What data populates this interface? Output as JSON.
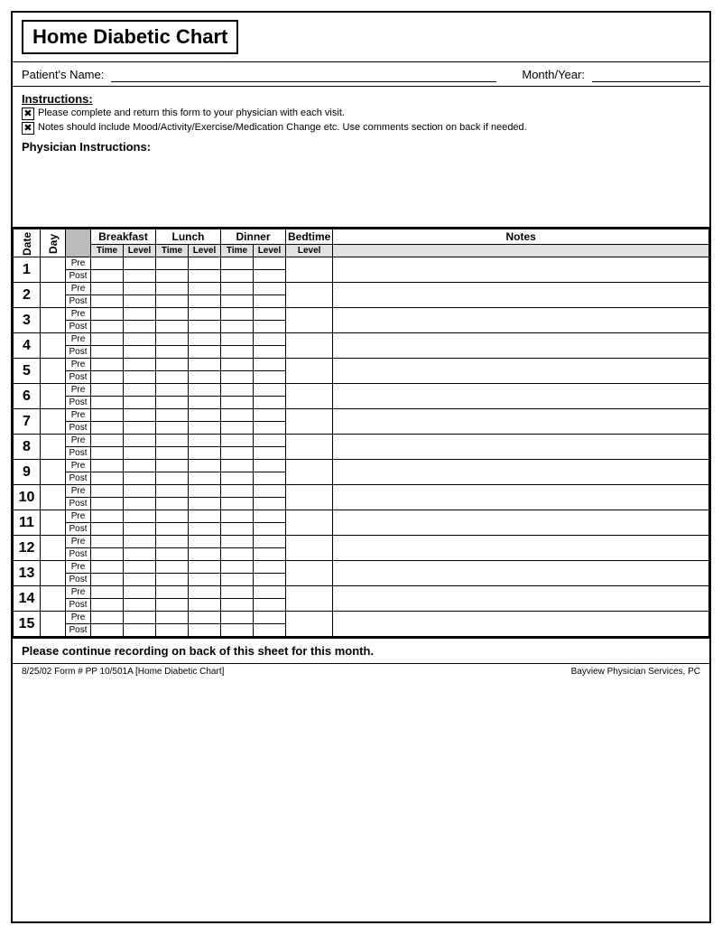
{
  "title": "Home Diabetic Chart",
  "patient_label": "Patient's Name:",
  "month_label": "Month/Year:",
  "instructions_title": "Instructions:",
  "instruction_1": "Please complete and return this form to your physician with each visit.",
  "instruction_2": "Notes should include Mood/Activity/Exercise/Medication Change etc.  Use comments section on back if needed.",
  "physician_label": "Physician Instructions:",
  "columns": {
    "date": "Date",
    "day": "Day",
    "breakfast": "Breakfast",
    "lunch": "Lunch",
    "dinner": "Dinner",
    "bedtime": "Bedtime",
    "notes": "Notes",
    "time": "Time",
    "level": "Level"
  },
  "prepost": [
    "Pre",
    "Post"
  ],
  "days": [
    1,
    2,
    3,
    4,
    5,
    6,
    7,
    8,
    9,
    10,
    11,
    12,
    13,
    14,
    15
  ],
  "footer_text": "Please continue recording on back of this sheet for this month.",
  "footer_meta": "8/25/02  Form #  PP 10/501A   [Home Diabetic Chart]",
  "footer_company": "Bayview Physician Services, PC"
}
